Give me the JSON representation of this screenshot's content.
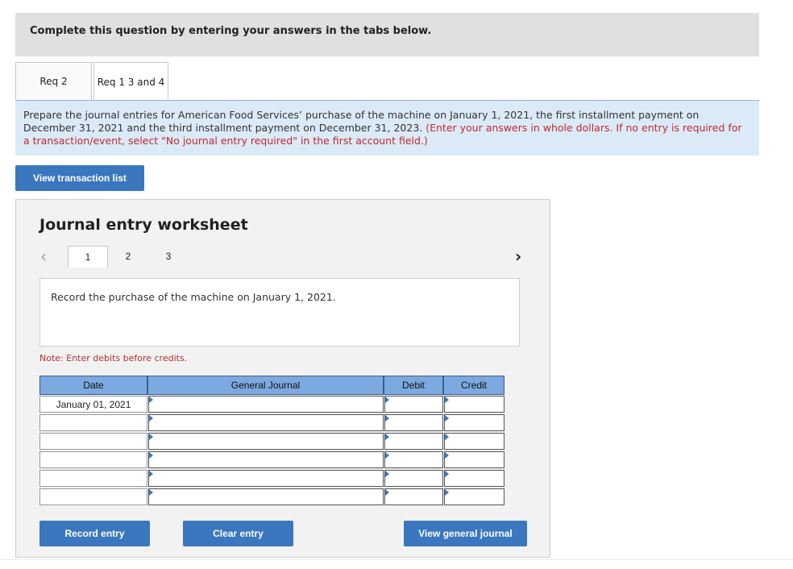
{
  "instructions": {
    "text": "Complete this question by entering your answers in the tabs below."
  },
  "tabs": [
    {
      "label": "Req 2",
      "active": false
    },
    {
      "label": "Req 1 3 and 4",
      "active": true
    }
  ],
  "info": {
    "text": "Prepare the journal entries for American Food Services’ purchase of the machine on January 1, 2021, the first installment payment on December 31, 2021 and the third installment payment on December 31, 2023.",
    "red_text": "(Enter your answers in whole dollars. If no entry is required for a transaction/event, select \"No journal entry required\" in the first account field.)"
  },
  "view_transaction_button": "View transaction list",
  "worksheet": {
    "title": "Journal entry worksheet",
    "pages": [
      "1",
      "2",
      "3"
    ],
    "active_page": "1",
    "prev_icon": "chevron-left-icon",
    "next_icon": "chevron-right-icon",
    "record_text": "Record the purchase of the machine on January 1, 2021.",
    "note": "Note: Enter debits before credits.",
    "table": {
      "headers": {
        "date": "Date",
        "journal": "General Journal",
        "debit": "Debit",
        "credit": "Credit"
      },
      "rows": [
        {
          "date": "January 01, 2021",
          "account": "",
          "debit": "",
          "credit": ""
        },
        {
          "date": "",
          "account": "",
          "debit": "",
          "credit": ""
        },
        {
          "date": "",
          "account": "",
          "debit": "",
          "credit": ""
        },
        {
          "date": "",
          "account": "",
          "debit": "",
          "credit": ""
        },
        {
          "date": "",
          "account": "",
          "debit": "",
          "credit": ""
        },
        {
          "date": "",
          "account": "",
          "debit": "",
          "credit": ""
        }
      ]
    },
    "buttons": {
      "record": "Record entry",
      "clear": "Clear entry",
      "view_journal": "View general journal"
    }
  },
  "colors": {
    "button": "#3a77bf",
    "header": "#7ba9e0",
    "info_bg": "#dbeaf7",
    "red": "#c0282d"
  }
}
